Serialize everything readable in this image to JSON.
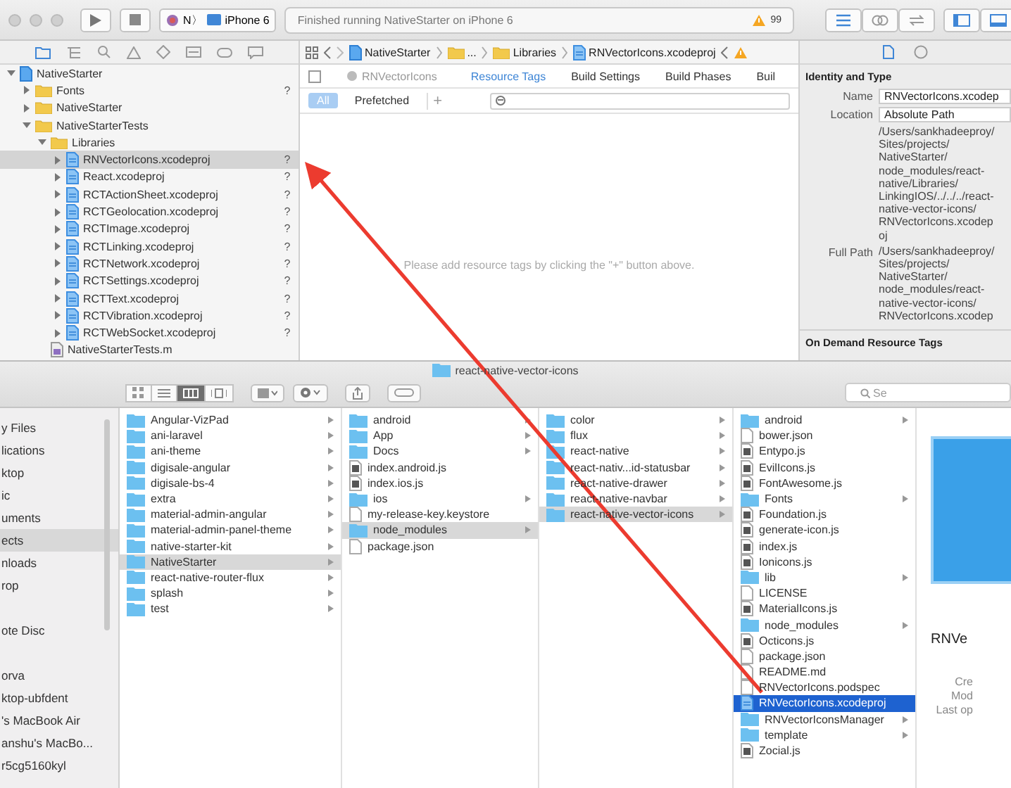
{
  "toolbar": {
    "scheme": "N〉",
    "device": "iPhone 6",
    "status": "Finished running NativeStarter on iPhone 6",
    "warning_count": "99"
  },
  "navigator": {
    "tree": [
      {
        "label": "NativeStarter",
        "kind": "project",
        "expanded": true,
        "selected": false,
        "children": [
          {
            "label": "Fonts",
            "kind": "folder",
            "expanded": false,
            "selected": false,
            "status": "?"
          },
          {
            "label": "NativeStarter",
            "kind": "folder",
            "expanded": false,
            "selected": false
          },
          {
            "label": "NativeStarterTests",
            "kind": "folder",
            "expanded": true,
            "selected": false,
            "children": [
              {
                "label": "Libraries",
                "kind": "folder",
                "expanded": true,
                "selected": false,
                "children": [
                  {
                    "label": "RNVectorIcons.xcodeproj",
                    "kind": "xcodeproj",
                    "expanded": false,
                    "selected": true,
                    "status": "?"
                  },
                  {
                    "label": "React.xcodeproj",
                    "kind": "xcodeproj",
                    "expanded": false,
                    "selected": false,
                    "status": "?"
                  },
                  {
                    "label": "RCTActionSheet.xcodeproj",
                    "kind": "xcodeproj",
                    "expanded": false,
                    "selected": false,
                    "status": "?"
                  },
                  {
                    "label": "RCTGeolocation.xcodeproj",
                    "kind": "xcodeproj",
                    "expanded": false,
                    "selected": false,
                    "status": "?"
                  },
                  {
                    "label": "RCTImage.xcodeproj",
                    "kind": "xcodeproj",
                    "expanded": false,
                    "selected": false,
                    "status": "?"
                  },
                  {
                    "label": "RCTLinking.xcodeproj",
                    "kind": "xcodeproj",
                    "expanded": false,
                    "selected": false,
                    "status": "?"
                  },
                  {
                    "label": "RCTNetwork.xcodeproj",
                    "kind": "xcodeproj",
                    "expanded": false,
                    "selected": false,
                    "status": "?"
                  },
                  {
                    "label": "RCTSettings.xcodeproj",
                    "kind": "xcodeproj",
                    "expanded": false,
                    "selected": false,
                    "status": "?"
                  },
                  {
                    "label": "RCTText.xcodeproj",
                    "kind": "xcodeproj",
                    "expanded": false,
                    "selected": false,
                    "status": "?"
                  },
                  {
                    "label": "RCTVibration.xcodeproj",
                    "kind": "xcodeproj",
                    "expanded": false,
                    "selected": false,
                    "status": "?"
                  },
                  {
                    "label": "RCTWebSocket.xcodeproj",
                    "kind": "xcodeproj",
                    "expanded": false,
                    "selected": false,
                    "status": "?"
                  }
                ]
              },
              {
                "label": "NativeStarterTests.m",
                "kind": "source",
                "selected": false
              }
            ]
          }
        ]
      }
    ]
  },
  "editor": {
    "jump_bar": [
      {
        "label": "NativeStarter",
        "kind": "project"
      },
      {
        "label": "...",
        "kind": "folder"
      },
      {
        "label": "Libraries",
        "kind": "folder"
      },
      {
        "label": "RNVectorIcons.xcodeproj",
        "kind": "xcodeproj"
      }
    ],
    "target": "RNVectorIcons",
    "tabs": [
      {
        "label": "Resource Tags",
        "selected": true
      },
      {
        "label": "Build Settings",
        "selected": false
      },
      {
        "label": "Build Phases",
        "selected": false
      },
      {
        "label": "Buil",
        "selected": false
      }
    ],
    "filters": [
      {
        "label": "All",
        "selected": true
      },
      {
        "label": "Prefetched",
        "selected": false
      }
    ],
    "add_button": "+",
    "empty_message": "Please add resource tags by clicking the \"+\" button above."
  },
  "inspector": {
    "section": "Identity and Type",
    "name_label": "Name",
    "name_value": "RNVectorIcons.xcodep",
    "location_label": "Location",
    "location_value": "Absolute Path",
    "location_path": [
      "/Users/sankhadeeproy/",
      "Sites/projects/",
      "NativeStarter/",
      "node_modules/react-",
      "native/Libraries/",
      "LinkingIOS/../../../react-",
      "native-vector-icons/",
      "RNVectorIcons.xcodep",
      "oj"
    ],
    "full_path_label": "Full Path",
    "full_path": [
      "/Users/sankhadeeproy/",
      "Sites/projects/",
      "NativeStarter/",
      "node_modules/react-",
      "native-vector-icons/",
      "RNVectorIcons.xcodep"
    ],
    "section_2": "On Demand Resource Tags"
  },
  "finder": {
    "title": "react-native-vector-icons",
    "search": {
      "placeholder": "Se"
    },
    "sidebar": [
      [
        {
          "label": "y Files",
          "selected": false
        },
        {
          "label": "lications",
          "selected": false
        },
        {
          "label": "ktop",
          "selected": false
        },
        {
          "label": "ic",
          "selected": false
        },
        {
          "label": "uments",
          "selected": false
        },
        {
          "label": "ects",
          "selected": true
        },
        {
          "label": "nloads",
          "selected": false
        },
        {
          "label": "rop",
          "selected": false
        }
      ],
      [
        {
          "label": "ote Disc",
          "selected": false
        }
      ],
      [
        {
          "label": "orva",
          "selected": false
        },
        {
          "label": "ktop-ubfdent",
          "selected": false
        },
        {
          "label": "'s MacBook Air",
          "selected": false
        },
        {
          "label": "anshu's MacBo...",
          "selected": false
        },
        {
          "label": "r5cg5160kyl",
          "selected": false
        }
      ]
    ],
    "columns": [
      [
        {
          "label": "Angular-VizPad",
          "kind": "folder",
          "selected": false
        },
        {
          "label": "ani-laravel",
          "kind": "folder",
          "selected": false
        },
        {
          "label": "ani-theme",
          "kind": "folder",
          "selected": false
        },
        {
          "label": "digisale-angular",
          "kind": "folder",
          "selected": false
        },
        {
          "label": "digisale-bs-4",
          "kind": "folder",
          "selected": false
        },
        {
          "label": "extra",
          "kind": "folder",
          "selected": false
        },
        {
          "label": "material-admin-angular",
          "kind": "folder",
          "selected": false
        },
        {
          "label": "material-admin-panel-theme",
          "kind": "folder",
          "selected": false
        },
        {
          "label": "native-starter-kit",
          "kind": "folder",
          "selected": false
        },
        {
          "label": "NativeStarter",
          "kind": "folder",
          "selected": true
        },
        {
          "label": "react-native-router-flux",
          "kind": "folder",
          "selected": false
        },
        {
          "label": "splash",
          "kind": "folder",
          "selected": false
        },
        {
          "label": "test",
          "kind": "folder",
          "selected": false
        }
      ],
      [
        {
          "label": "android",
          "kind": "folder",
          "selected": false
        },
        {
          "label": "App",
          "kind": "folder",
          "selected": false
        },
        {
          "label": "Docs",
          "kind": "folder",
          "selected": false
        },
        {
          "label": "index.android.js",
          "kind": "script",
          "selected": false
        },
        {
          "label": "index.ios.js",
          "kind": "script",
          "selected": false
        },
        {
          "label": "ios",
          "kind": "folder",
          "selected": false
        },
        {
          "label": "my-release-key.keystore",
          "kind": "file",
          "selected": false
        },
        {
          "label": "node_modules",
          "kind": "folder",
          "selected": true
        },
        {
          "label": "package.json",
          "kind": "file",
          "selected": false
        }
      ],
      [
        {
          "label": "color",
          "kind": "folder",
          "selected": false
        },
        {
          "label": "flux",
          "kind": "folder",
          "selected": false
        },
        {
          "label": "react-native",
          "kind": "folder",
          "selected": false
        },
        {
          "label": "react-nativ...id-statusbar",
          "kind": "folder",
          "selected": false
        },
        {
          "label": "react-native-drawer",
          "kind": "folder",
          "selected": false
        },
        {
          "label": "react-native-navbar",
          "kind": "folder",
          "selected": false
        },
        {
          "label": "react-native-vector-icons",
          "kind": "folder",
          "selected": true
        }
      ],
      [
        {
          "label": "android",
          "kind": "folder",
          "selected": false
        },
        {
          "label": "bower.json",
          "kind": "file",
          "selected": false
        },
        {
          "label": "Entypo.js",
          "kind": "script",
          "selected": false
        },
        {
          "label": "EvilIcons.js",
          "kind": "script",
          "selected": false
        },
        {
          "label": "FontAwesome.js",
          "kind": "script",
          "selected": false
        },
        {
          "label": "Fonts",
          "kind": "folder",
          "selected": false
        },
        {
          "label": "Foundation.js",
          "kind": "script",
          "selected": false
        },
        {
          "label": "generate-icon.js",
          "kind": "script",
          "selected": false
        },
        {
          "label": "index.js",
          "kind": "script",
          "selected": false
        },
        {
          "label": "Ionicons.js",
          "kind": "script",
          "selected": false
        },
        {
          "label": "lib",
          "kind": "folder",
          "selected": false
        },
        {
          "label": "LICENSE",
          "kind": "file",
          "selected": false
        },
        {
          "label": "MaterialIcons.js",
          "kind": "script",
          "selected": false
        },
        {
          "label": "node_modules",
          "kind": "folder",
          "selected": false
        },
        {
          "label": "Octicons.js",
          "kind": "script",
          "selected": false
        },
        {
          "label": "package.json",
          "kind": "file",
          "selected": false
        },
        {
          "label": "README.md",
          "kind": "file",
          "selected": false
        },
        {
          "label": "RNVectorIcons.podspec",
          "kind": "file",
          "selected": false
        },
        {
          "label": "RNVectorIcons.xcodeproj",
          "kind": "xcodeproj",
          "selected": true
        },
        {
          "label": "RNVectorIconsManager",
          "kind": "folder",
          "selected": false
        },
        {
          "label": "template",
          "kind": "folder",
          "selected": false
        },
        {
          "label": "Zocial.js",
          "kind": "script",
          "selected": false
        }
      ]
    ],
    "preview": {
      "name": "RNVe",
      "meta": [
        "Cre",
        "Mod",
        "Last op"
      ]
    }
  }
}
